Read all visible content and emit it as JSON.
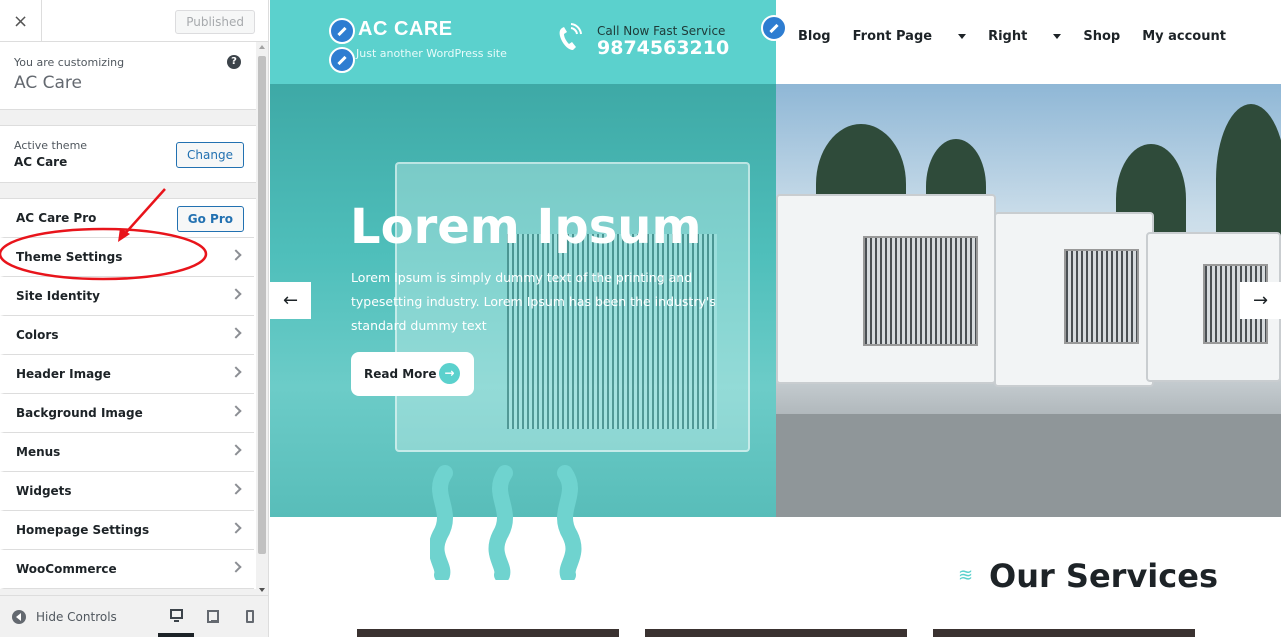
{
  "sidebar": {
    "close_label": "×",
    "published_label": "Published",
    "customizing_small": "You are customizing",
    "customizing_site": "AC Care",
    "help_label": "?",
    "active_theme_small": "Active theme",
    "active_theme_name": "AC Care",
    "change_label": "Change",
    "items": [
      {
        "label": "AC Care Pro",
        "button": "Go Pro"
      },
      {
        "label": "Theme Settings"
      },
      {
        "label": "Site Identity"
      },
      {
        "label": "Colors"
      },
      {
        "label": "Header Image"
      },
      {
        "label": "Background Image"
      },
      {
        "label": "Menus"
      },
      {
        "label": "Widgets"
      },
      {
        "label": "Homepage Settings"
      },
      {
        "label": "WooCommerce"
      }
    ],
    "hide_controls_label": "Hide Controls",
    "annotation_color": "#e8141b"
  },
  "preview": {
    "site_title": "AC CARE",
    "tagline": "Just another WordPress site",
    "call_label": "Call Now Fast Service",
    "call_number": "9874563210",
    "nav": [
      "Blog",
      "Front Page",
      "Right",
      "Shop",
      "My account"
    ],
    "hero_title": "Lorem Ipsum",
    "hero_text": "Lorem Ipsum is simply dummy text of the printing and typesetting industry. Lorem Ipsum has been the industry's standard dummy text",
    "read_more": "Read More",
    "services_title": "Our Services",
    "accent_color": "#5bd1cd"
  }
}
